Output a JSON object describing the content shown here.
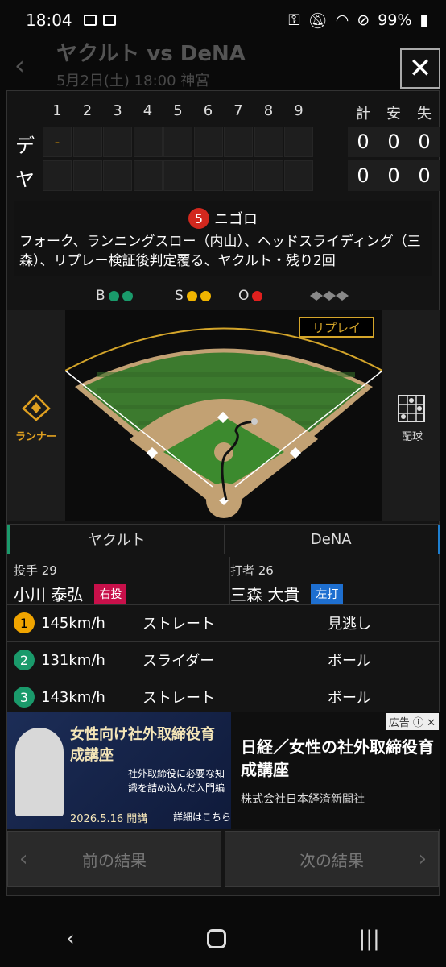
{
  "status_bar": {
    "time": "18:04",
    "battery": "99%"
  },
  "background_header": {
    "title": "ヤクルト vs DeNA",
    "subtitle": "5月2日(土) 18:00 神宮"
  },
  "close_label": "✕",
  "scoreboard": {
    "innings": [
      "1",
      "2",
      "3",
      "4",
      "5",
      "6",
      "7",
      "8",
      "9"
    ],
    "total_headers": [
      "計",
      "安",
      "失"
    ],
    "rows": [
      {
        "team": "デ",
        "scores": [
          "-",
          "",
          "",
          "",
          "",
          "",
          "",
          "",
          ""
        ],
        "totals": [
          "0",
          "0",
          "0"
        ]
      },
      {
        "team": "ヤ",
        "scores": [
          "",
          "",
          "",
          "",
          "",
          "",
          "",
          "",
          ""
        ],
        "totals": [
          "0",
          "0",
          "0"
        ]
      }
    ]
  },
  "play": {
    "inning": "5",
    "title": "ニゴロ",
    "description": "フォーク、ランニングスロー（内山）、ヘッドスライディング（三森）、リプレー検証後判定覆る、ヤクルト・残り2回"
  },
  "count": {
    "b_label": "B",
    "s_label": "S",
    "o_label": "O",
    "balls": 2,
    "strikes": 2,
    "outs": 1
  },
  "field": {
    "replay_label": "リプレイ",
    "runner_label": "ランナー",
    "pitch_label": "配球"
  },
  "teams": {
    "home": "ヤクルト",
    "away": "DeNA"
  },
  "pitcher": {
    "role": "投手 29",
    "name": "小川 泰弘",
    "hand": "右投"
  },
  "batter": {
    "role": "打者 26",
    "name": "三森 大貴",
    "hand": "左打"
  },
  "pitches": [
    {
      "num": "1",
      "speed": "145km/h",
      "type": "ストレート",
      "result": "見逃し",
      "color": "#f0a400"
    },
    {
      "num": "2",
      "speed": "131km/h",
      "type": "スライダー",
      "result": "ボール",
      "color": "#1a9a6b"
    },
    {
      "num": "3",
      "speed": "143km/h",
      "type": "ストレート",
      "result": "ボール",
      "color": "#1a9a6b"
    }
  ],
  "ad": {
    "badge": "広告",
    "banner_title": "女性向け社外取締役育成講座",
    "banner_sub": "社外取締役に必要な知識を詰め込んだ入門編",
    "banner_date": "2026.5.16 開講",
    "banner_link": "詳細はこちら",
    "headline": "日経／女性の社外取締役育成講座",
    "company": "株式会社日本経済新聞社"
  },
  "nav": {
    "prev": "前の結果",
    "next": "次の結果"
  }
}
